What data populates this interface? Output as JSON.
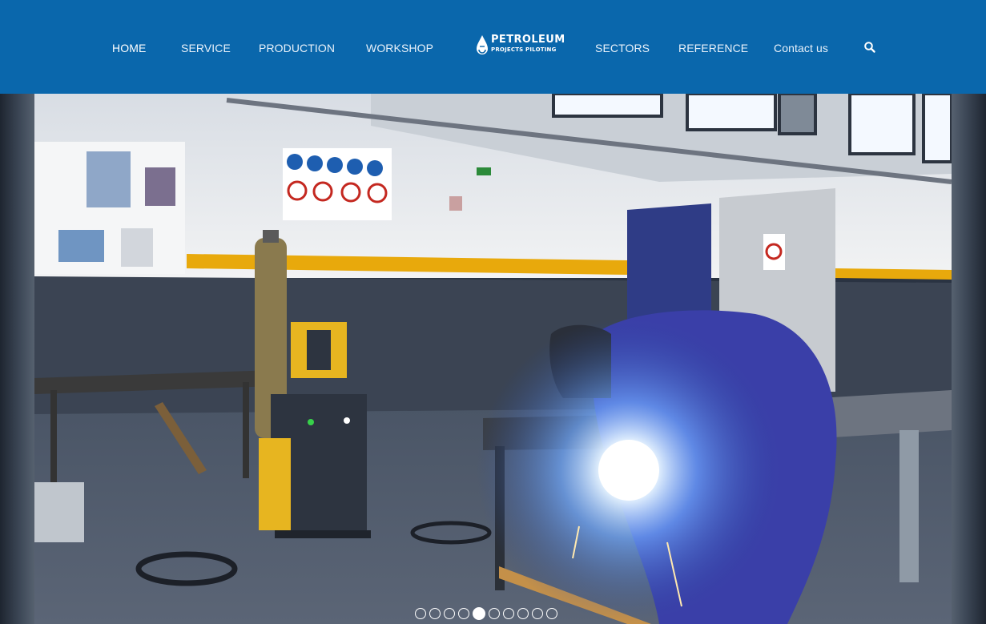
{
  "header": {
    "nav_left": [
      {
        "label": "HOME",
        "active": true
      },
      {
        "label": "SERVICE",
        "active": false
      },
      {
        "label": "PRODUCTION",
        "active": false
      },
      {
        "label": "WORKSHOP",
        "active": false
      }
    ],
    "logo": {
      "line1": "PETROLEUM",
      "line2": "PROJECTS PILOTING"
    },
    "nav_right": [
      {
        "label": "SECTORS"
      },
      {
        "label": "REFERENCE"
      },
      {
        "label": "Contact us"
      }
    ],
    "search_icon": "search-icon"
  },
  "slider": {
    "slide_count": 10,
    "active_slide": 5
  },
  "colors": {
    "header_bg": "#0a67ac",
    "nav_text": "#e8f1fa",
    "safety_stripe": "#e8a90c",
    "welder_coat": "#3a3fa8",
    "welding_arc": "#cfe7ff"
  }
}
